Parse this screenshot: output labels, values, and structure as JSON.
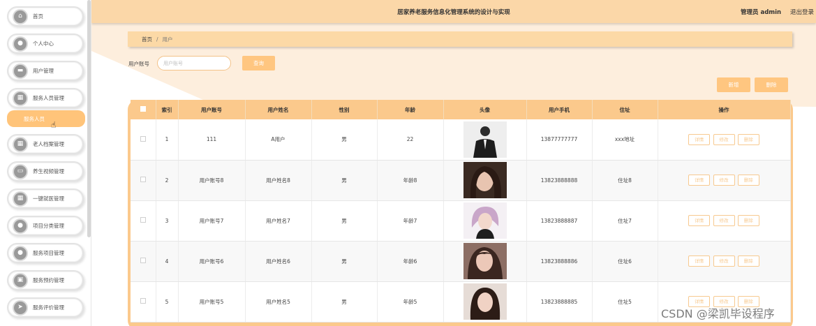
{
  "header": {
    "title": "居家养老服务信息化管理系统的设计与实现",
    "admin": "管理员 admin",
    "logout": "退出登录"
  },
  "sidebar": {
    "items": [
      {
        "label": "首页",
        "icon": "home-icon"
      },
      {
        "label": "个人中心",
        "icon": "user-icon"
      },
      {
        "label": "用户管理",
        "icon": "users-icon"
      },
      {
        "label": "服务人员管理",
        "icon": "grid-icon"
      },
      {
        "label": "老人档案管理",
        "icon": "grid-icon"
      },
      {
        "label": "养生视频管理",
        "icon": "video-icon"
      },
      {
        "label": "一键就医管理",
        "icon": "grid-icon"
      },
      {
        "label": "项目分类管理",
        "icon": "user-icon"
      },
      {
        "label": "服务项目管理",
        "icon": "user-icon"
      },
      {
        "label": "服务预约管理",
        "icon": "calendar-icon"
      },
      {
        "label": "服务评价管理",
        "icon": "send-icon"
      }
    ],
    "subitem": "服务人员"
  },
  "breadcrumb": {
    "home": "首页",
    "sep": "/",
    "current": "用户"
  },
  "search": {
    "label": "用户账号",
    "placeholder": "用户账号",
    "button": "查询"
  },
  "actions": {
    "add": "新增",
    "delete": "删除"
  },
  "table": {
    "headers": [
      "索引",
      "用户账号",
      "用户姓名",
      "性别",
      "年龄",
      "头像",
      "用户手机",
      "住址",
      "操作"
    ],
    "ops": {
      "detail": "详情",
      "edit": "修改",
      "delete": "删除"
    },
    "rows": [
      {
        "index": "1",
        "account": "111",
        "name": "A用户",
        "gender": "男",
        "age": "22",
        "phone": "13877777777",
        "address": "xxx地址"
      },
      {
        "index": "2",
        "account": "用户账号8",
        "name": "用户姓名8",
        "gender": "男",
        "age": "年龄8",
        "phone": "13823888888",
        "address": "住址8"
      },
      {
        "index": "3",
        "account": "用户账号7",
        "name": "用户姓名7",
        "gender": "男",
        "age": "年龄7",
        "phone": "13823888887",
        "address": "住址7"
      },
      {
        "index": "4",
        "account": "用户账号6",
        "name": "用户姓名6",
        "gender": "男",
        "age": "年龄6",
        "phone": "13823888886",
        "address": "住址6"
      },
      {
        "index": "5",
        "account": "用户账号5",
        "name": "用户姓名5",
        "gender": "男",
        "age": "年龄5",
        "phone": "13823888885",
        "address": "住址5"
      }
    ]
  },
  "watermark": "CSDN @梁凯毕设程序",
  "colors": {
    "accent": "#ffc680",
    "header": "#fbd7a8",
    "table_head": "#fbc98c"
  }
}
